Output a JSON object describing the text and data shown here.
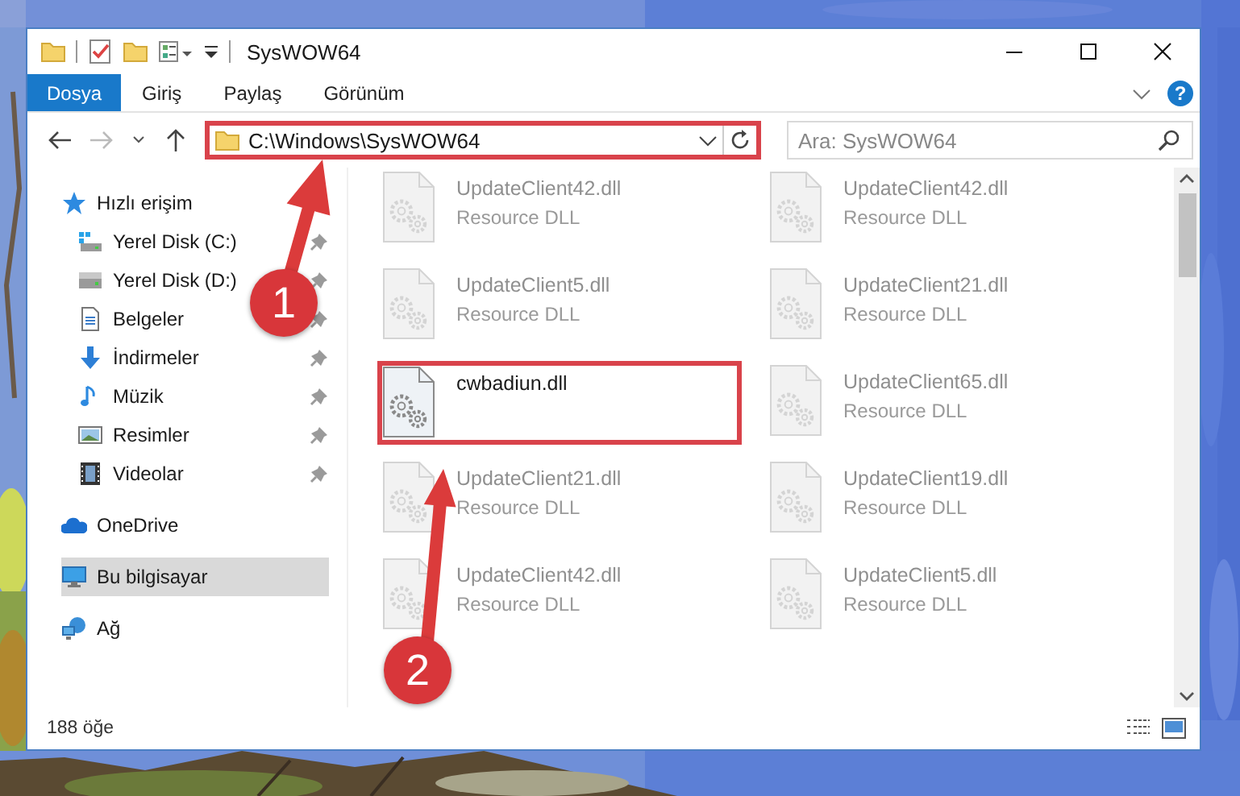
{
  "window": {
    "title": "SysWOW64"
  },
  "ribbon": {
    "tabs": [
      {
        "label": "Dosya",
        "kind": "menu"
      },
      {
        "label": "Giriş",
        "kind": "tab"
      },
      {
        "label": "Paylaş",
        "kind": "tab"
      },
      {
        "label": "Görünüm",
        "kind": "tab"
      }
    ],
    "help": "?"
  },
  "address": {
    "path": "C:\\Windows\\SysWOW64",
    "highlighted": true
  },
  "search": {
    "placeholder": "Ara: SysWOW64"
  },
  "nav": {
    "items": [
      {
        "label": "Hızlı erişim",
        "kind": "star",
        "pinned": false,
        "selected": false,
        "children": [
          {
            "label": "Yerel Disk (C:)",
            "kind": "system-drive",
            "pinned": true,
            "selected": false
          },
          {
            "label": "Yerel Disk (D:)",
            "kind": "drive",
            "pinned": true,
            "selected": false
          },
          {
            "label": "Belgeler",
            "kind": "document",
            "pinned": true,
            "selected": false
          },
          {
            "label": "İndirmeler",
            "kind": "download",
            "pinned": true,
            "selected": false
          },
          {
            "label": "Müzik",
            "kind": "music",
            "pinned": true,
            "selected": false
          },
          {
            "label": "Resimler",
            "kind": "pictures",
            "pinned": true,
            "selected": false
          },
          {
            "label": "Videolar",
            "kind": "videos",
            "pinned": true,
            "selected": false
          }
        ]
      },
      {
        "label": "OneDrive",
        "kind": "cloud",
        "pinned": false,
        "selected": false
      },
      {
        "label": "Bu bilgisayar",
        "kind": "computer",
        "pinned": false,
        "selected": true
      },
      {
        "label": "Ağ",
        "kind": "network",
        "pinned": false,
        "selected": false
      }
    ]
  },
  "files": [
    {
      "name": "UpdateClient42.dll",
      "description": "Resource DLL",
      "faded": true,
      "highlighted": false
    },
    {
      "name": "UpdateClient42.dll",
      "description": "Resource DLL",
      "faded": true,
      "highlighted": false
    },
    {
      "name": "UpdateClient5.dll",
      "description": "Resource DLL",
      "faded": true,
      "highlighted": false
    },
    {
      "name": "UpdateClient21.dll",
      "description": "Resource DLL",
      "faded": true,
      "highlighted": false
    },
    {
      "name": "cwbadiun.dll",
      "faded": false,
      "highlighted": true
    },
    {
      "name": "UpdateClient65.dll",
      "description": "Resource DLL",
      "faded": true,
      "highlighted": false
    },
    {
      "name": "UpdateClient21.dll",
      "description": "Resource DLL",
      "faded": true,
      "highlighted": false
    },
    {
      "name": "UpdateClient19.dll",
      "description": "Resource DLL",
      "faded": true,
      "highlighted": false
    },
    {
      "name": "UpdateClient42.dll",
      "description": "Resource DLL",
      "faded": true,
      "highlighted": false
    },
    {
      "name": "UpdateClient5.dll",
      "description": "Resource DLL",
      "faded": true,
      "highlighted": false
    }
  ],
  "status_bar": {
    "count": "188 öğe"
  },
  "annotations": [
    {
      "number": "1"
    },
    {
      "number": "2"
    }
  ]
}
